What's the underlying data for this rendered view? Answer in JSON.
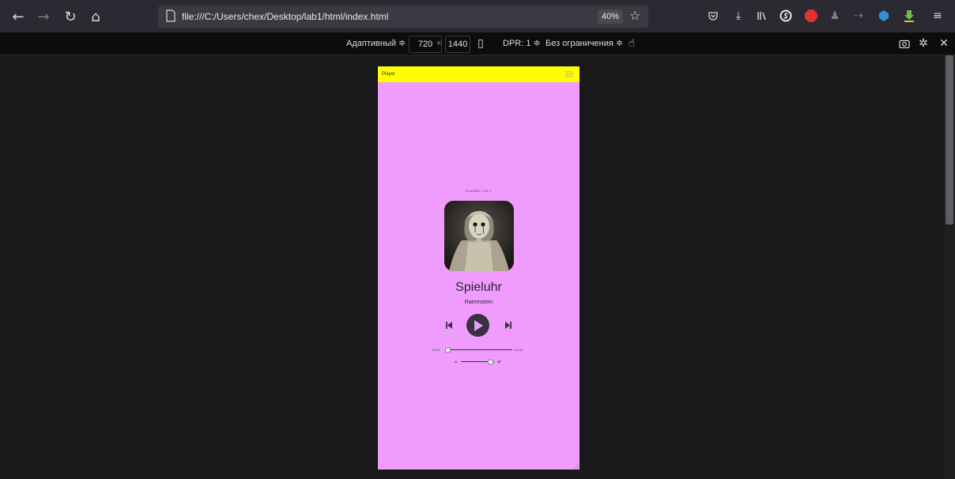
{
  "browser": {
    "url": "file:///C:/Users/chex/Desktop/lab1/html/index.html",
    "zoom": "40%"
  },
  "rdm": {
    "mode": "Адаптивный ≑",
    "width": "720",
    "times": "×",
    "height": "1440",
    "dpr": "DPR: 1  ≑",
    "throttle": "Без ограничения ≑"
  },
  "app": {
    "title": "Player",
    "playing_label": "PLAYING 1 OF 1",
    "song_title": "Spieluhr",
    "artist": "Rammstein",
    "time_current": "00:00",
    "time_total": "04:46",
    "progress_fraction": 0.0,
    "volume_fraction": 0.85
  },
  "colors": {
    "header": "#ffff00",
    "background": "#f09cff",
    "controls": "#3a3040"
  }
}
